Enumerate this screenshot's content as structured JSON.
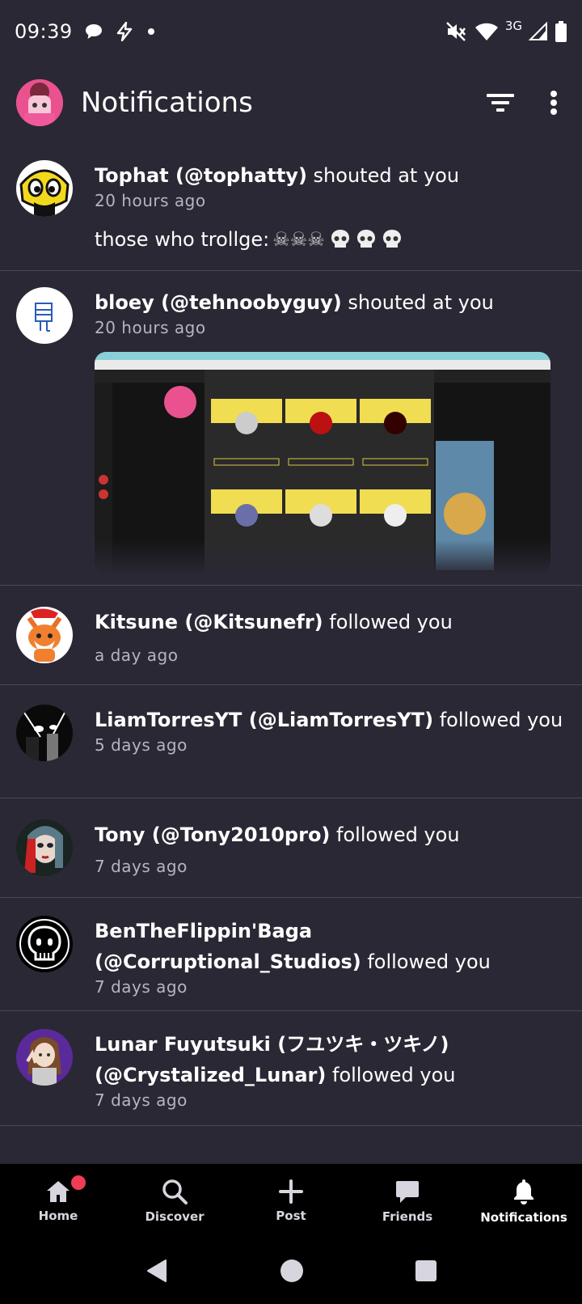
{
  "status_bar": {
    "time": "09:39",
    "network": "3G",
    "icons": [
      "chat-bubble-icon",
      "lightning-icon",
      "dot-icon",
      "mute-icon",
      "wifi-icon",
      "signal-icon",
      "battery-icon"
    ]
  },
  "header": {
    "title": "Notifications",
    "icons": [
      "filter-icon",
      "more-vert-icon"
    ]
  },
  "notifications": [
    {
      "name": "Tophat (@tophatty)",
      "action": " shouted at you",
      "time": "20 hours ago",
      "message": "those who trollge: "
    },
    {
      "name": "bloey (@tehnoobyguy)",
      "action": " shouted at you",
      "time": "20 hours ago"
    },
    {
      "name": "Kitsune (@Kitsunefr)",
      "action": " followed you",
      "time": "a day ago"
    },
    {
      "name": "LiamTorresYT (@LiamTorresYT)",
      "action": " followed you",
      "time": "5 days ago"
    },
    {
      "name": "Tony (@Tony2010pro)",
      "action": " followed you",
      "time": "7 days ago"
    },
    {
      "name": "BenTheFlippin'Baga (@Corruptional_Studios)",
      "action": " followed you",
      "time": "7 days ago"
    },
    {
      "name": "Lunar Fuyutsuki (フユツキ・ツキノ) (@Crystalized_Lunar)",
      "action": " followed you",
      "time": "7 days ago"
    }
  ],
  "bottom_nav": [
    {
      "label": "Home",
      "icon": "home-icon"
    },
    {
      "label": "Discover",
      "icon": "search-icon"
    },
    {
      "label": "Post",
      "icon": "plus-icon"
    },
    {
      "label": "Friends",
      "icon": "chat-icon"
    },
    {
      "label": "Notifications",
      "icon": "bell-icon",
      "active": true
    }
  ],
  "colors": {
    "background": "#2a2834",
    "divider": "#4a4854",
    "badge": "#f03c54",
    "nav_bg": "#000000"
  }
}
